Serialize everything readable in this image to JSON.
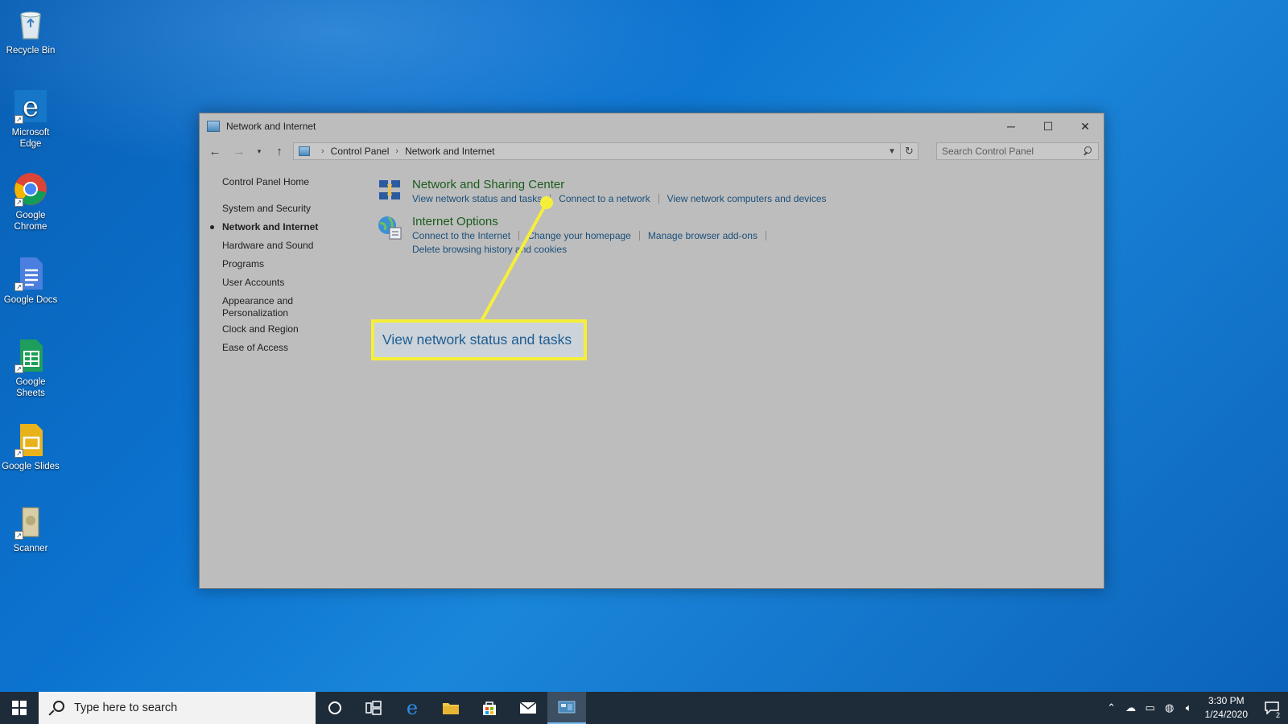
{
  "desktop": {
    "icons": [
      {
        "label": "Recycle Bin",
        "icon": "recycle-bin-icon"
      },
      {
        "label": "Microsoft Edge",
        "icon": "edge-icon"
      },
      {
        "label": "Google Chrome",
        "icon": "chrome-icon"
      },
      {
        "label": "Google Docs",
        "icon": "google-docs-icon"
      },
      {
        "label": "Google Sheets",
        "icon": "google-sheets-icon"
      },
      {
        "label": "Google Slides",
        "icon": "google-slides-icon"
      },
      {
        "label": "Scanner",
        "icon": "scanner-icon"
      }
    ]
  },
  "window": {
    "title": "Network and Internet",
    "breadcrumb": [
      "Control Panel",
      "Network and Internet"
    ],
    "search_placeholder": "Search Control Panel"
  },
  "sidebar": {
    "home": "Control Panel Home",
    "items": [
      {
        "label": "System and Security"
      },
      {
        "label": "Network and Internet",
        "active": true
      },
      {
        "label": "Hardware and Sound"
      },
      {
        "label": "Programs"
      },
      {
        "label": "User Accounts"
      },
      {
        "label": "Appearance and"
      },
      {
        "label": "Personalization"
      },
      {
        "label": "Clock and Region"
      },
      {
        "label": "Ease of Access"
      }
    ]
  },
  "categories": [
    {
      "title": "Network and Sharing Center",
      "links": [
        "View network status and tasks",
        "Connect to a network",
        "View network computers and devices"
      ]
    },
    {
      "title": "Internet Options",
      "links": [
        "Connect to the Internet",
        "Change your homepage",
        "Manage browser add-ons",
        "Delete browsing history and cookies"
      ]
    }
  ],
  "callout": {
    "text": "View network status and tasks",
    "color": "#f6ef3a"
  },
  "taskbar": {
    "search_placeholder": "Type here to search",
    "time": "3:30 PM",
    "date": "1/24/2020",
    "notification_count": "2"
  },
  "colors": {
    "link": "#1a4f7a",
    "category_title": "#1b5c1b",
    "taskbar": "#1e2c3a"
  }
}
